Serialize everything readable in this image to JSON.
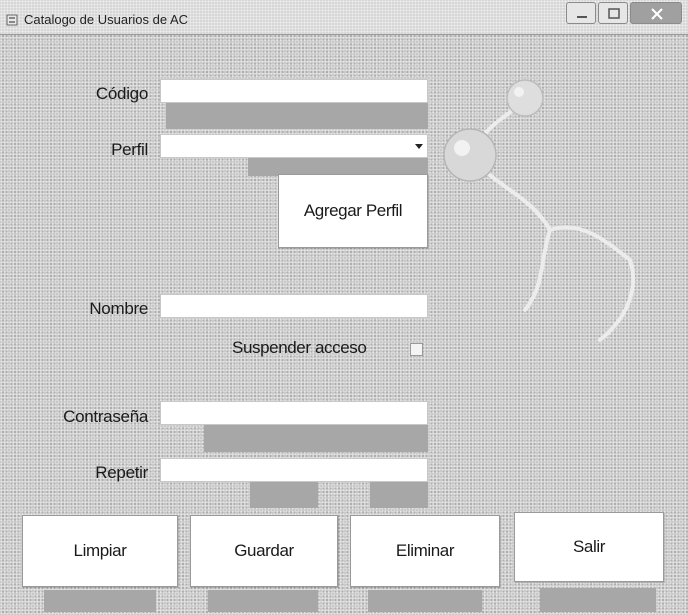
{
  "window": {
    "title": "Catalogo de Usuarios de AC"
  },
  "form": {
    "codigo": {
      "label": "Código",
      "value": ""
    },
    "perfil": {
      "label": "Perfil",
      "value": ""
    },
    "agregar_perfil_label": "Agregar Perfil",
    "nombre": {
      "label": "Nombre",
      "value": ""
    },
    "suspender_label": "Suspender acceso",
    "contrasena": {
      "label": "Contraseña",
      "value": ""
    },
    "repetir": {
      "label": "Repetir",
      "value": ""
    }
  },
  "actions": {
    "limpiar": "Limpiar",
    "guardar": "Guardar",
    "eliminar": "Eliminar",
    "salir": "Salir"
  },
  "colors": {
    "window_bg": "#c9c9c9",
    "input_bg": "#ffffff",
    "accent_bar": "#a7a7a7"
  },
  "icons": {
    "app": "app-icon",
    "minimize": "minimize-icon",
    "maximize": "maximize-icon",
    "close": "close-icon",
    "dropdown": "chevron-down-icon"
  }
}
